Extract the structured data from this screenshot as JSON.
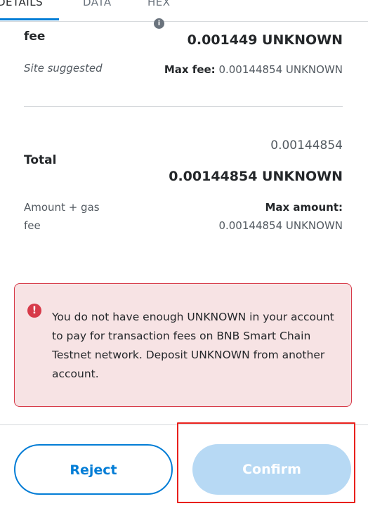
{
  "tabs": {
    "details": "DETAILS",
    "data": "DATA",
    "hex": "HEX"
  },
  "gas": {
    "label": "fee",
    "info_glyph": "i",
    "value": "0.001449 UNKNOWN",
    "site_suggested": "Site suggested",
    "max_fee_label": "Max fee:",
    "max_fee_value": "0.00144854 UNKNOWN"
  },
  "total": {
    "label": "Total",
    "small_value": "0.00144854",
    "big_value": "0.00144854 UNKNOWN",
    "amount_gas_line1": "Amount + gas",
    "amount_gas_line2": "fee",
    "max_amount_label": "Max amount:",
    "max_amount_value": "0.00144854 UNKNOWN"
  },
  "error": {
    "icon": "!",
    "message": "You do not have enough UNKNOWN in your account to pay for transaction fees on BNB Smart Chain Testnet network. Deposit UNKNOWN from another account."
  },
  "footer": {
    "reject_label": "Reject",
    "confirm_label": "Confirm"
  },
  "colors": {
    "primary": "#037dd6",
    "error": "#d73a49",
    "error_bg": "#f7e3e4",
    "confirm_disabled": "#b7d9f4",
    "highlight": "#e8201c"
  }
}
